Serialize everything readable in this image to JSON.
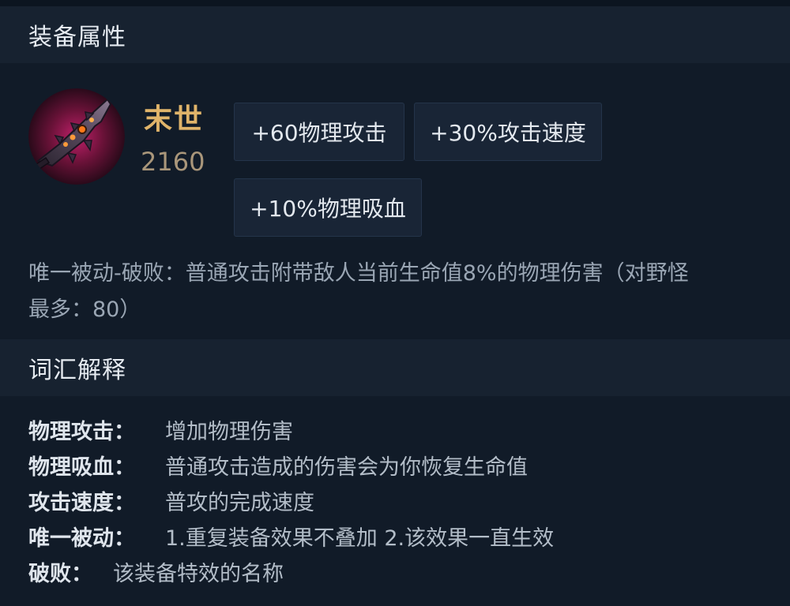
{
  "header": {
    "title": "装备属性"
  },
  "item": {
    "name": "末世",
    "price": "2160",
    "icon": "dagger-blade-icon",
    "stats": [
      "+60物理攻击",
      "+30%攻击速度",
      "+10%物理吸血"
    ],
    "passive_line1": "唯一被动-破败：普通攻击附带敌人当前生命值8%的物理伤害（对野怪",
    "passive_line2": "最多：80）"
  },
  "glossary": {
    "title": "词汇解释",
    "entries": [
      {
        "term": "物理攻击：",
        "definition": "增加物理伤害"
      },
      {
        "term": "物理吸血：",
        "definition": "普通攻击造成的伤害会为你恢复生命值"
      },
      {
        "term": "攻击速度：",
        "definition": "普攻的完成速度"
      },
      {
        "term": "唯一被动：",
        "definition": "1.重复装备效果不叠加 2.该效果一直生效"
      },
      {
        "term": "破败：",
        "definition": "该装备特效的名称"
      }
    ]
  },
  "colors": {
    "name_gold": "#e0b46a",
    "price_tan": "#a9967a",
    "background": "#111b28",
    "header_bg": "#172230"
  }
}
